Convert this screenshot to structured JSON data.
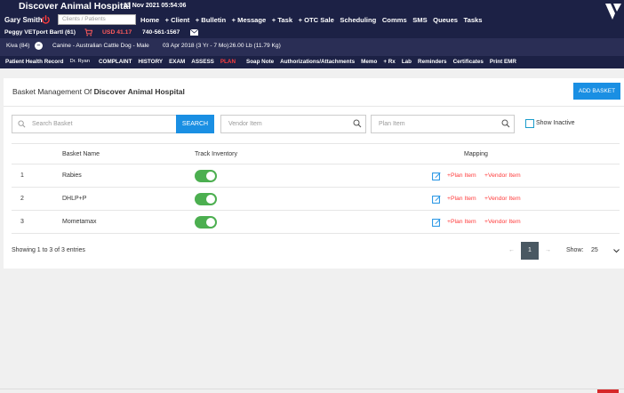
{
  "header": {
    "hospital_name": "Discover Animal Hospital",
    "datetime": "23 Nov 2021 05:54:06",
    "user_name": "Gary Smith",
    "search_placeholder": "Clients / Patients",
    "nav": [
      "Home",
      "+ Client",
      "+ Bulletin",
      "+ Message",
      "+ Task",
      "+ OTC Sale",
      "Scheduling",
      "Comms",
      "SMS",
      "Queues",
      "Tasks"
    ]
  },
  "client_bar": {
    "client": "Peggy VETport Bartl (61)",
    "balance": "USD 41.17",
    "phone": "740-561-1567"
  },
  "patient_bar": {
    "pet": "Kiva (84)",
    "toggle": "–",
    "species": "Canine - Australian Cattle Dog - Male",
    "dob": "03 Apr 2018 (3 Yr - 7 Mo)",
    "weight": "26.00 Lb (11.79 Kg)"
  },
  "record_tabs": {
    "label": "Patient Health Record",
    "doctor": "Dr. Ryan",
    "tabs": [
      "COMPLAINT",
      "HISTORY",
      "EXAM",
      "ASSESS"
    ],
    "active": "PLAN",
    "links": [
      "Soap Note",
      "Authorizations/Attachments",
      "Memo",
      "+ Rx",
      "Lab",
      "Reminders",
      "Certificates",
      "Print EMR"
    ]
  },
  "main": {
    "title_prefix": "Basket Management Of",
    "title_hospital": "Discover Animal Hospital",
    "add_button": "ADD BASKET",
    "search_placeholder": "Search Basket",
    "search_button": "SEARCH",
    "vendor_placeholder": "Vendor Item",
    "plan_placeholder": "Plan Item",
    "show_inactive": "Show Inactive",
    "columns": {
      "name": "Basket Name",
      "track": "Track Inventory",
      "mapping": "Mapping"
    },
    "rows": [
      {
        "num": "1",
        "name": "Rabies",
        "track": true,
        "plan_link": "+Plan Item",
        "vendor_link": "+Vendor Item"
      },
      {
        "num": "2",
        "name": "DHLP+P",
        "track": true,
        "plan_link": "+Plan Item",
        "vendor_link": "+Vendor Item"
      },
      {
        "num": "3",
        "name": "Mometamax",
        "track": true,
        "plan_link": "+Plan Item",
        "vendor_link": "+Vendor Item"
      }
    ],
    "entries_text": "Showing 1 to 3 of 3 entries",
    "pager_prev": "←",
    "current_page": "1",
    "pager_next": "→",
    "show_label": "Show:",
    "page_size": "25"
  },
  "colors": {
    "navy": "#1c2145",
    "accent_blue": "#1a8fe3",
    "toggle_green": "#4caf50",
    "link_red": "#ff3b3b"
  }
}
